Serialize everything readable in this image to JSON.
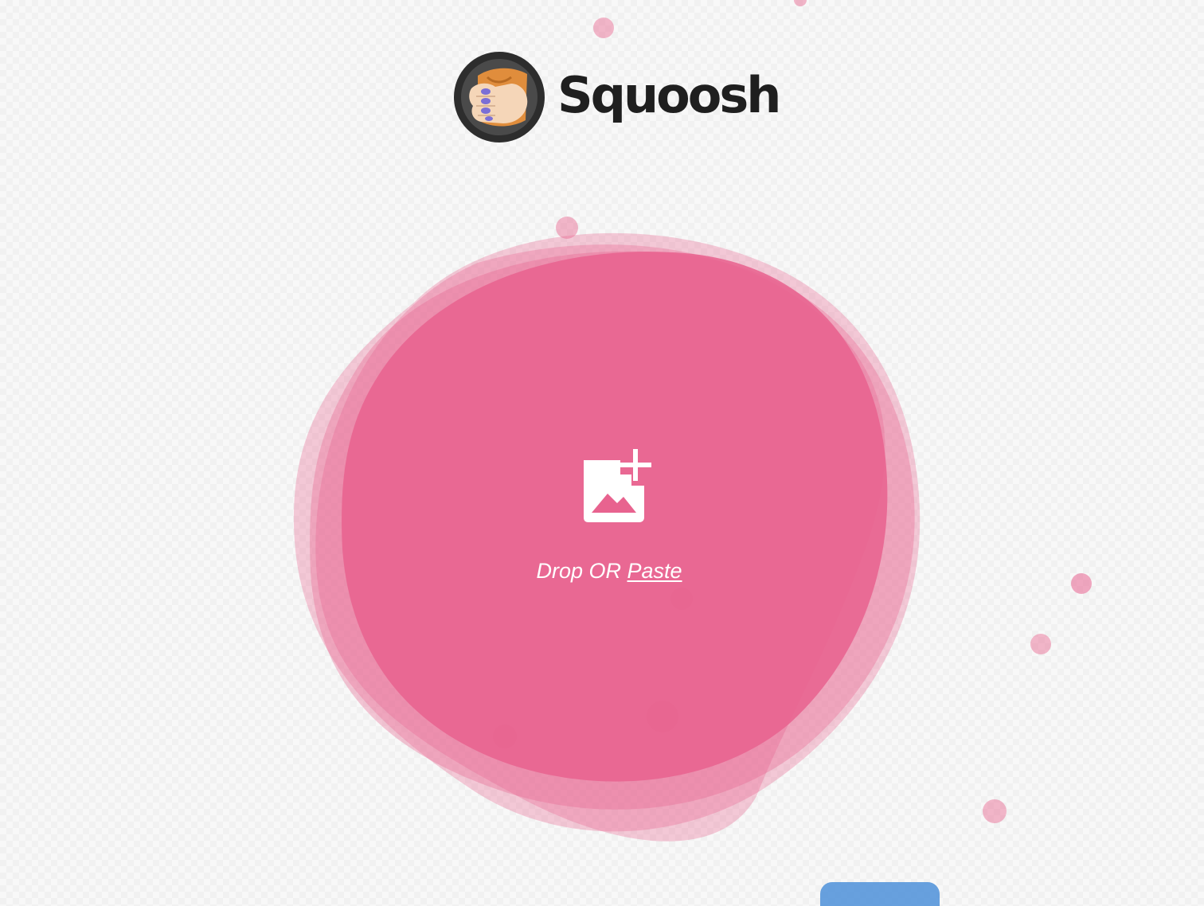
{
  "app": {
    "name": "Squoosh"
  },
  "drop_zone": {
    "text_drop": "Drop OR",
    "text_paste": "Paste",
    "icon": "add-image-icon"
  },
  "colors": {
    "blob_pink": "#e8638f",
    "text_dark": "#1f1f1f",
    "text_on_blob": "#ffffff",
    "accent_blue": "#4d90d9"
  }
}
